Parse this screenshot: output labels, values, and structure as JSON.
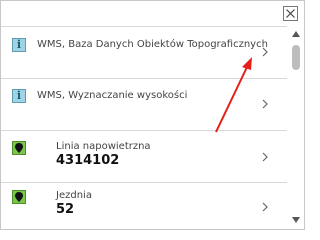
{
  "close_icon": "close-icon",
  "items": [
    {
      "type": "wms",
      "label": "WMS, Baza Danych Obiektów Topograficznych"
    },
    {
      "type": "wms",
      "label": "WMS, Wyznaczanie wysokości"
    },
    {
      "type": "feature",
      "label": "Linia napowietrzna",
      "value": "4314102"
    },
    {
      "type": "feature",
      "label": "Jezdnia",
      "value": "52"
    }
  ],
  "info_glyph": "i",
  "colors": {
    "info_bg": "#9fd3e6",
    "marker_bg": "#7bc54b",
    "annotation_arrow": "#e32119"
  }
}
